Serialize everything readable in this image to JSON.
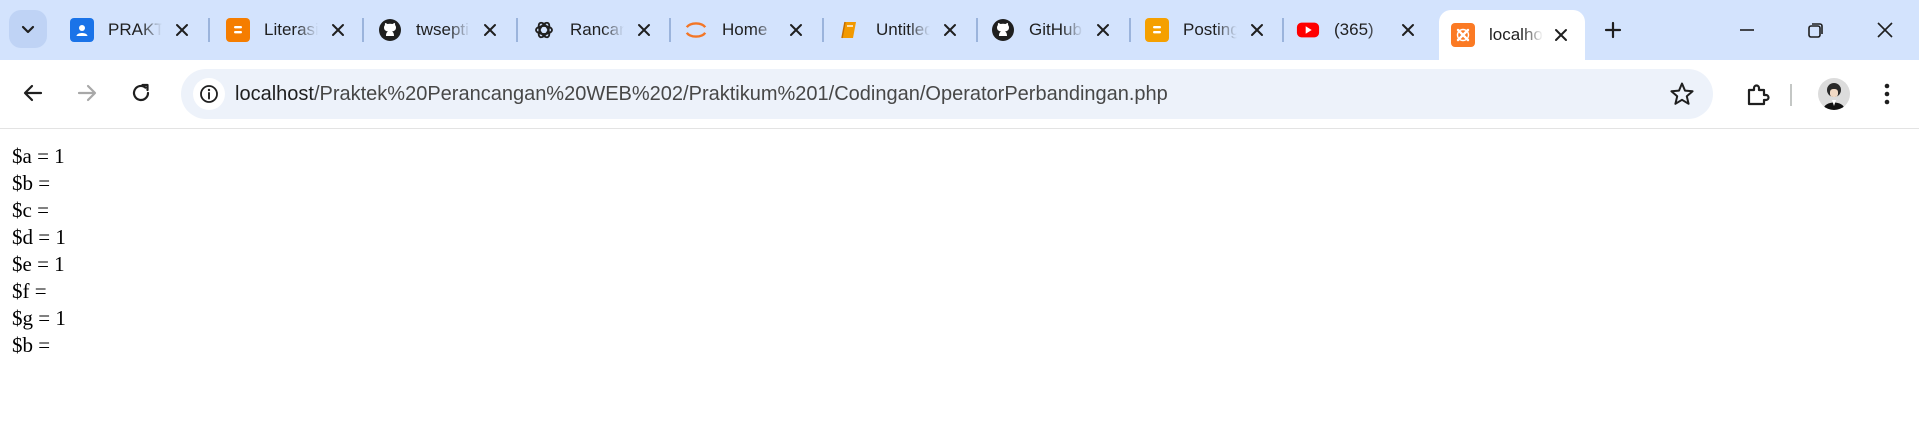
{
  "tabs": [
    {
      "title": "PRAKTIKUM",
      "favicon": "google-classroom-icon",
      "color": "#1a73e8"
    },
    {
      "title": "Literasi Digital",
      "favicon": "blogger-icon",
      "color": "#f57d00"
    },
    {
      "title": "twsepti",
      "favicon": "github-icon",
      "color": "#1f1f1f"
    },
    {
      "title": "Rancangan",
      "favicon": "openai-icon",
      "color": "#1f1f1f"
    },
    {
      "title": "Home",
      "favicon": "jupyter-icon",
      "color": "#f37626"
    },
    {
      "title": "Untitled",
      "favicon": "book-icon",
      "color": "#f29900"
    },
    {
      "title": "GitHub",
      "favicon": "github-icon",
      "color": "#1f1f1f"
    },
    {
      "title": "Posting",
      "favicon": "blogger-icon",
      "color": "#f5a000"
    },
    {
      "title": "(365)",
      "favicon": "youtube-icon",
      "color": "#ff0000"
    },
    {
      "title": "localhost",
      "favicon": "xampp-icon",
      "color": "#fb7a24",
      "active": true
    }
  ],
  "omnibox": {
    "host": "localhost",
    "path": "/Praktek%20Perancangan%20WEB%202/Praktikum%201/Codingan/OperatorPerbandingan.php"
  },
  "output_lines": [
    "$a = 1",
    "$b =",
    "$c =",
    "$d = 1",
    "$e = 1",
    "$f =",
    "$g = 1",
    "$b ="
  ]
}
